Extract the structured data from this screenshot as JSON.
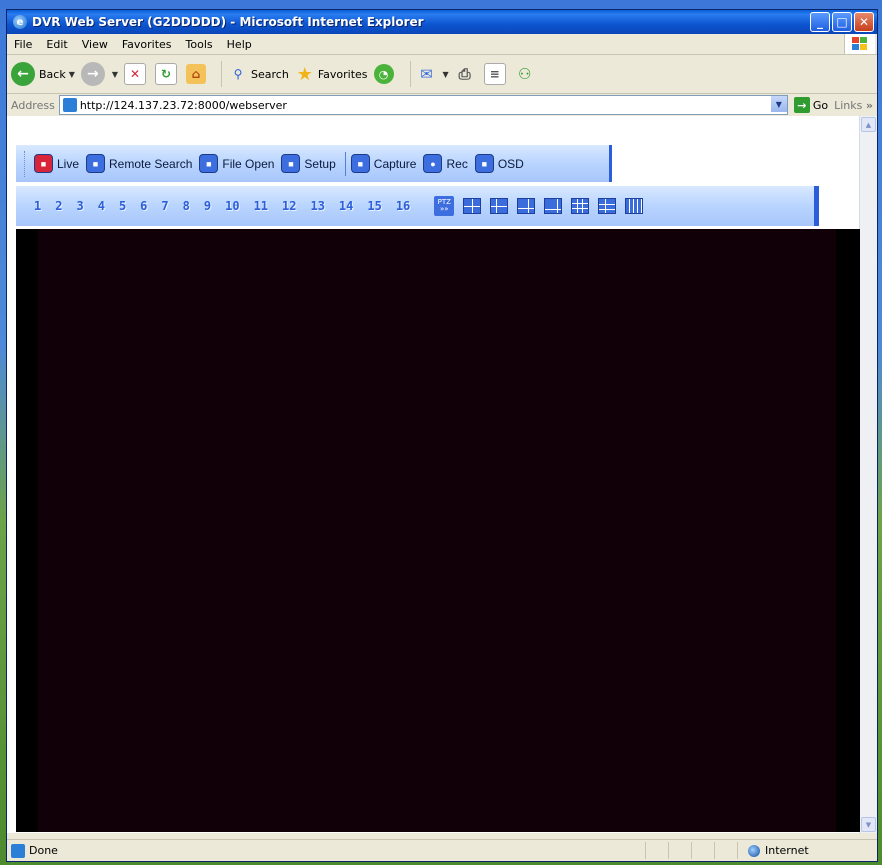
{
  "window": {
    "title": "DVR Web Server (G2DDDDD) - Microsoft Internet Explorer",
    "min": "_",
    "max": "□",
    "close": "✕"
  },
  "menu": [
    "File",
    "Edit",
    "View",
    "Favorites",
    "Tools",
    "Help"
  ],
  "toolbar": {
    "back": "Back",
    "search": "Search",
    "favorites": "Favorites"
  },
  "address": {
    "label": "Address",
    "url": "http://124.137.23.72:8000/webserver",
    "go": "Go",
    "links": "Links",
    "more": "»"
  },
  "dvr": {
    "top_buttons": [
      {
        "label": "Live",
        "color": "#d8253a"
      },
      {
        "label": "Remote Search",
        "color": "#3d6ee0"
      },
      {
        "label": "File Open",
        "color": "#3d6ee0"
      },
      {
        "label": "Setup",
        "color": "#3d6ee0"
      }
    ],
    "action_buttons": [
      {
        "label": "Capture",
        "color": "#3d6ee0"
      },
      {
        "label": "Rec",
        "color": "#3d6ee0"
      },
      {
        "label": "OSD",
        "color": "#3d6ee0"
      }
    ],
    "channels": [
      "1",
      "2",
      "3",
      "4",
      "5",
      "6",
      "7",
      "8",
      "9",
      "10",
      "11",
      "12",
      "13",
      "14",
      "15",
      "16"
    ],
    "ptz_label": "PTZ",
    "ptz_arrows": "»»"
  },
  "status": {
    "text": "Done",
    "zone": "Internet"
  }
}
